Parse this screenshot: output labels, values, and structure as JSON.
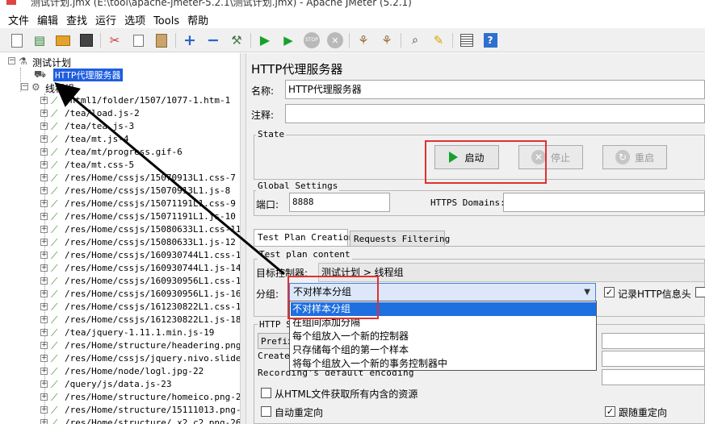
{
  "window": {
    "title_partial": "测试计划.jmx (E:\\tool\\apache-jmeter-5.2.1\\测试计划.jmx) - Apache JMeter (5.2.1)"
  },
  "menu": [
    "文件",
    "编辑",
    "查找",
    "运行",
    "选项",
    "Tools",
    "帮助"
  ],
  "toolbar_icons": [
    "new-icon",
    "templates-icon",
    "open-icon",
    "save-icon",
    "cut-icon",
    "copy-icon",
    "paste-icon",
    "expand-icon",
    "collapse-icon",
    "toggle-icon",
    "start-icon",
    "start-no-pauses-icon",
    "stop-icon",
    "shutdown-icon",
    "clear-icon",
    "clear-all-icon",
    "search-icon",
    "reset-search-icon",
    "function-helper-icon",
    "help-icon"
  ],
  "tree": {
    "root": "测试计划",
    "proxy": "HTTP代理服务器",
    "thread_group": "线程组",
    "samplers": [
      "/html1/folder/1507/1077-1.htm-1",
      "/tea/load.js-2",
      "/tea/tea.js-3",
      "/tea/mt.js-4",
      "/tea/mt/progress.gif-6",
      "/tea/mt.css-5",
      "/res/Home/cssjs/15070913L1.css-7",
      "/res/Home/cssjs/15070913L1.js-8",
      "/res/Home/cssjs/15071191L1.css-9",
      "/res/Home/cssjs/15071191L1.js-10",
      "/res/Home/cssjs/15080633L1.css-11",
      "/res/Home/cssjs/15080633L1.js-12",
      "/res/Home/cssjs/160930744L1.css-13",
      "/res/Home/cssjs/160930744L1.js-14",
      "/res/Home/cssjs/160930956L1.css-15",
      "/res/Home/cssjs/160930956L1.js-16",
      "/res/Home/cssjs/161230822L1.css-17",
      "/res/Home/cssjs/161230822L1.js-18",
      "/tea/jquery-1.11.1.min.js-19",
      "/res/Home/structure/headering.png-2",
      "/res/Home/cssjs/jquery.nivo.slider.",
      "/res/Home/node/logl.jpg-22",
      "/query/js/data.js-23",
      "/res/Home/structure/homeico.png-24",
      "/res/Home/structure/15111013.png-25",
      "/res/Home/structure/_x2_c2.png-26"
    ]
  },
  "panel": {
    "title": "HTTP代理服务器",
    "name_label": "名称:",
    "name_value": "HTTP代理服务器",
    "comment_label": "注释:",
    "comment_value": "",
    "state_legend": "State",
    "start_button": "启动",
    "stop_button": "停止",
    "restart_button": "重启",
    "global_legend": "Global Settings",
    "port_label": "端口:",
    "port_value": "8888",
    "https_label": "HTTPS Domains:",
    "https_value": "",
    "tabs": [
      "Test Plan Creation",
      "Requests Filtering"
    ],
    "test_plan_content_legend": "Test plan content",
    "target_label": "目标控制器:",
    "target_value": "测试计划 > 线程组",
    "group_label": "分组:",
    "group_value": "不对样本分组",
    "group_options": [
      "不对样本分组",
      "在组间添加分隔",
      "每个组放入一个新的控制器",
      "只存储每个组的第一个样本",
      "将每个组放入一个新的事务控制器中"
    ],
    "record_headers_label": "记录HTTP信息头",
    "record_headers_checked": true,
    "http_sampler_legend_partial": "HTTP S",
    "prefix_button_partial": "Prefix",
    "create_label_partial": "Create",
    "recording_default_partial": "Recording's default encoding",
    "fetch_resources_label": "从HTML文件获取所有内含的资源",
    "fetch_resources_checked": false,
    "auto_redirect_label": "自动重定向",
    "auto_redirect_checked": false,
    "follow_redirect_label": "跟随重定向",
    "follow_redirect_checked": true
  },
  "colors": {
    "highlight_red": "#e03030",
    "selection_blue": "#1e5ee0",
    "start_green": "#18a02c"
  }
}
